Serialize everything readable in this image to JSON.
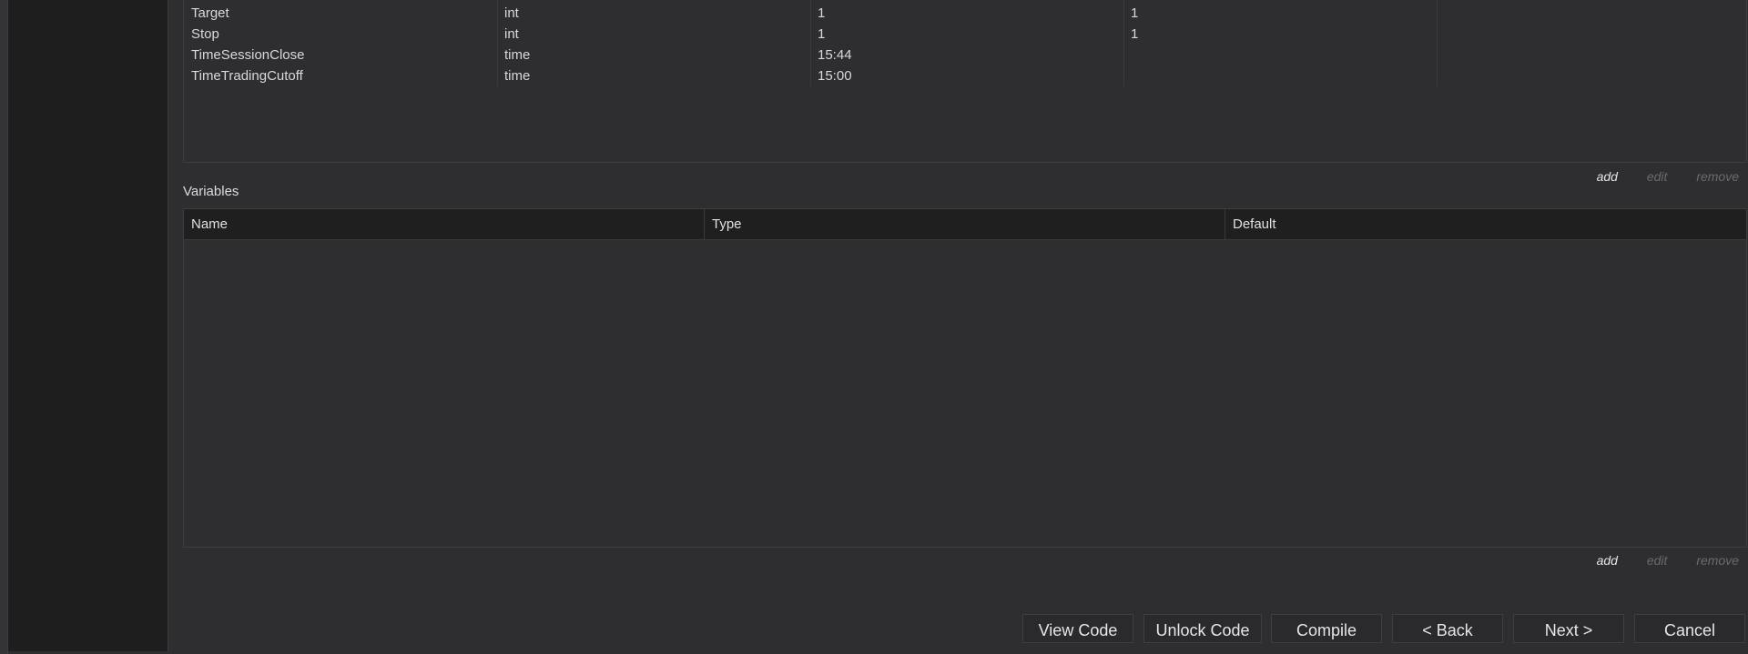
{
  "parameters": {
    "rows": [
      {
        "name": "Target",
        "type": "int",
        "default": "1",
        "min": "1"
      },
      {
        "name": "Stop",
        "type": "int",
        "default": "1",
        "min": "1"
      },
      {
        "name": "TimeSessionClose",
        "type": "time",
        "default": "15:44",
        "min": ""
      },
      {
        "name": "TimeTradingCutoff",
        "type": "time",
        "default": "15:00",
        "min": ""
      }
    ],
    "actions": {
      "add": "add",
      "edit": "edit",
      "remove": "remove"
    }
  },
  "variables": {
    "title": "Variables",
    "columns": {
      "name": "Name",
      "type": "Type",
      "default": "Default"
    },
    "rows": [],
    "actions": {
      "add": "add",
      "edit": "edit",
      "remove": "remove"
    }
  },
  "footer": {
    "view_code": "View Code",
    "unlock_code": "Unlock Code",
    "compile": "Compile",
    "back": "< Back",
    "next": "Next >",
    "cancel": "Cancel"
  }
}
